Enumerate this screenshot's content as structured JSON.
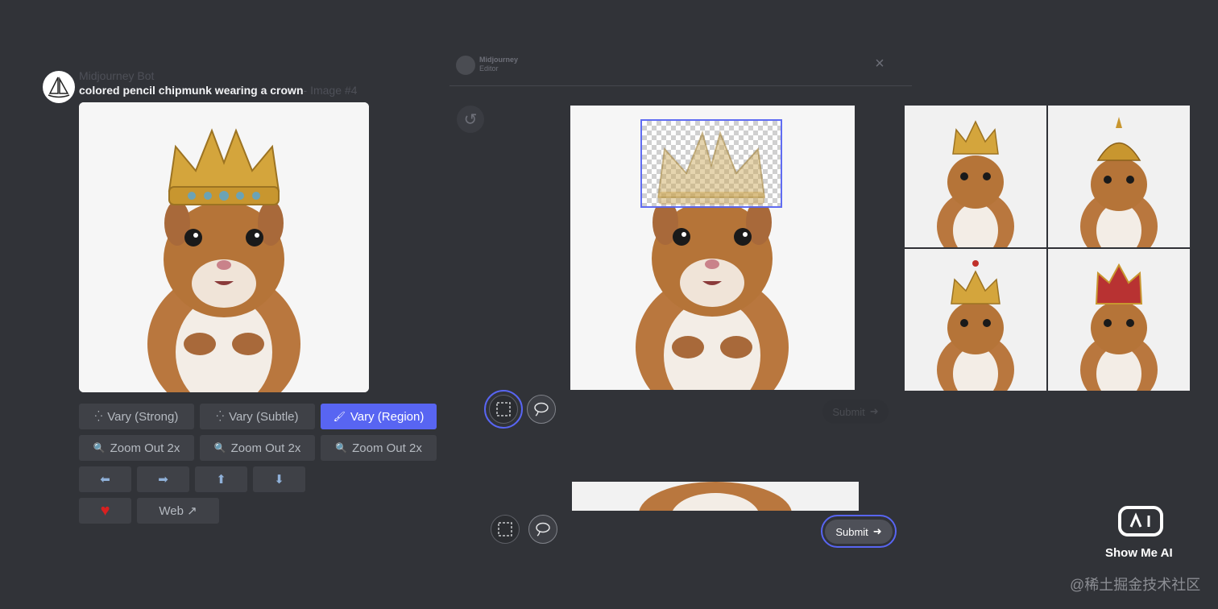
{
  "message": {
    "bot_name": "Midjourney Bot",
    "prompt": "colored pencil chipmunk wearing a crown",
    "prompt_suffix": "- Image #4"
  },
  "actions": {
    "vary_strong": "Vary (Strong)",
    "vary_subtle": "Vary (Subtle)",
    "vary_region": "Vary (Region)",
    "zoom_out_1": "Zoom Out 2x",
    "zoom_out_2": "Zoom Out 2x",
    "zoom_out_3": "Zoom Out 2x",
    "web": "Web ↗",
    "pan_left_icon": "⬅",
    "pan_right_icon": "➡",
    "pan_up_icon": "⬆",
    "pan_down_icon": "⬇",
    "heart_icon": "♥"
  },
  "editor": {
    "title_line1": "Midjourney",
    "title_line2": "Editor",
    "close_icon": "×",
    "undo_icon": "↺",
    "submit_1": "Submit",
    "submit_2": "Submit"
  },
  "watermark": {
    "showme": "Show Me AI",
    "juejin": "@稀土掘金技术社区"
  },
  "colors": {
    "accent": "#5865f2",
    "background": "#313338",
    "button": "#3f4147"
  }
}
